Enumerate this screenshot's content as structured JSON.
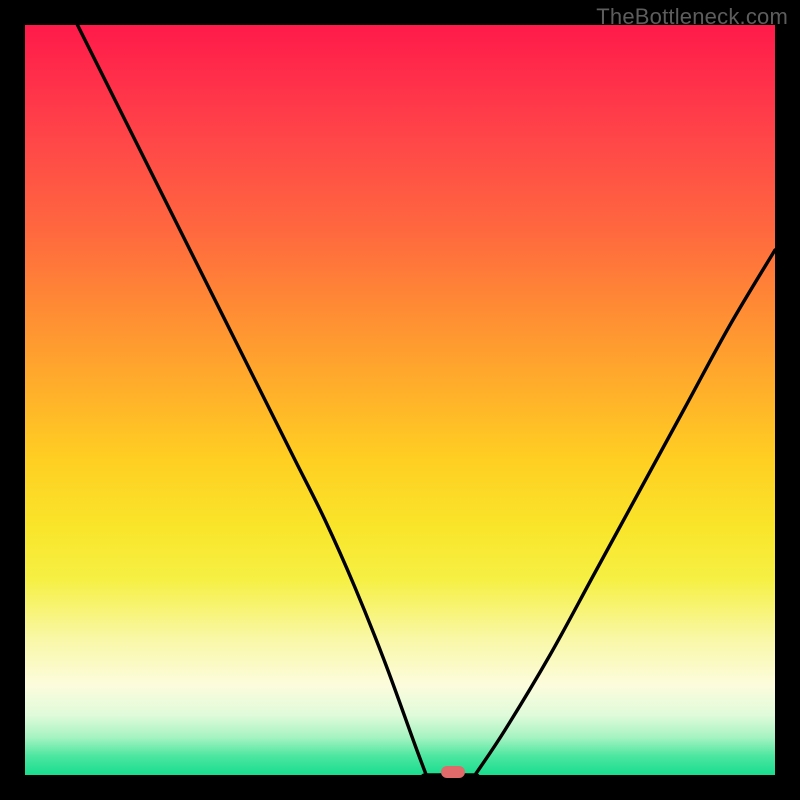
{
  "watermark": "TheBottleneck.com",
  "colors": {
    "background": "#000000",
    "curve": "#000000",
    "marker": "#e06a6a"
  },
  "chart_data": {
    "type": "line",
    "title": "",
    "xlabel": "",
    "ylabel": "",
    "xlim": [
      0,
      100
    ],
    "ylim": [
      0,
      100
    ],
    "grid": false,
    "legend": false,
    "series": [
      {
        "name": "left-curve",
        "x": [
          7,
          12,
          18,
          24,
          28,
          32,
          36,
          40,
          44,
          48,
          52,
          53.5
        ],
        "y": [
          100,
          90,
          78,
          66,
          58,
          50,
          42,
          34,
          25,
          15,
          4,
          0
        ]
      },
      {
        "name": "flat-bottom",
        "x": [
          53.5,
          60
        ],
        "y": [
          0,
          0
        ]
      },
      {
        "name": "right-curve",
        "x": [
          60,
          64,
          70,
          76,
          82,
          88,
          94,
          100
        ],
        "y": [
          0,
          6,
          16,
          27,
          38,
          49,
          60,
          70
        ]
      }
    ],
    "marker": {
      "x": 57,
      "y": 0
    }
  }
}
